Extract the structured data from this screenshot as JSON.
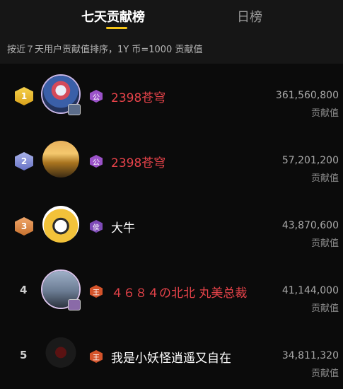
{
  "tabs": {
    "active": "七天贡献榜",
    "inactive": "日榜"
  },
  "subtitle": "按近７天用户贡献值排序，1Y 币=1000 贡献值",
  "colors": {
    "accent": "#f5c518",
    "vip_name": "#e8434a",
    "normal_name": "#ffffff"
  },
  "rows": [
    {
      "rank": "1",
      "badge": "公",
      "badge_color": "#9b52c9",
      "name": "2398苍穹",
      "name_color": "#e8434a",
      "score": "361,560,800",
      "score_label": "贡献值"
    },
    {
      "rank": "2",
      "badge": "公",
      "badge_color": "#9b52c9",
      "name": "2398苍穹",
      "name_color": "#e8434a",
      "score": "57,201,200",
      "score_label": "贡献值"
    },
    {
      "rank": "3",
      "badge": "侯",
      "badge_color": "#7e4ab7",
      "name": "大牛",
      "name_color": "#ffffff",
      "score": "43,870,600",
      "score_label": "贡献值"
    },
    {
      "rank": "4",
      "badge": "王",
      "badge_color": "#d4532a",
      "name": "４６８４の北北 丸美总裁",
      "name_color": "#e8434a",
      "score": "41,144,000",
      "score_label": "贡献值"
    },
    {
      "rank": "5",
      "badge": "王",
      "badge_color": "#d4532a",
      "name": "我是小妖怪逍遥又自在",
      "name_color": "#ffffff",
      "score": "34,811,320",
      "score_label": "贡献值"
    }
  ]
}
